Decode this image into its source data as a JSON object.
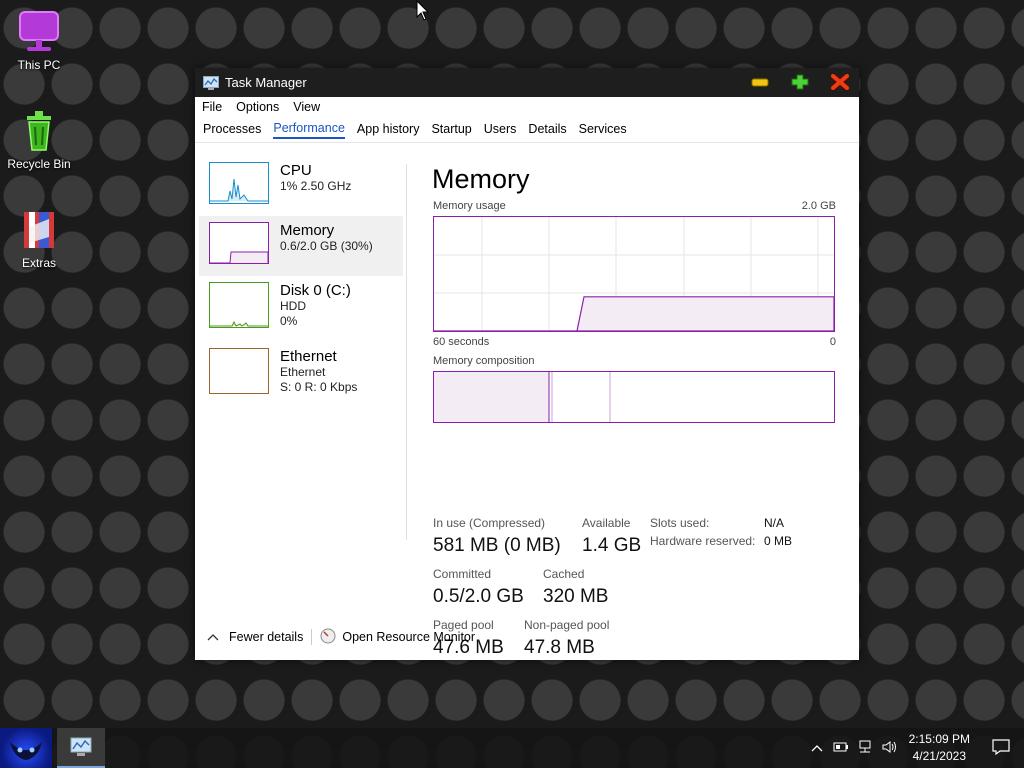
{
  "desktop": {
    "icons": [
      {
        "label": "This PC"
      },
      {
        "label": "Recycle Bin"
      },
      {
        "label": "Extras"
      }
    ]
  },
  "window": {
    "title": "Task Manager",
    "menu": [
      "File",
      "Options",
      "View"
    ],
    "tabs": [
      "Processes",
      "Performance",
      "App history",
      "Startup",
      "Users",
      "Details",
      "Services"
    ],
    "active_tab": "Performance"
  },
  "sidebar": {
    "items": [
      {
        "title": "CPU",
        "sub1": "1%  2.50 GHz",
        "sub2": "",
        "color": "#1a8fc7"
      },
      {
        "title": "Memory",
        "sub1": "0.6/2.0 GB (30%)",
        "sub2": "",
        "color": "#8b1fab"
      },
      {
        "title": "Disk 0 (C:)",
        "sub1": "HDD",
        "sub2": "0%",
        "color": "#4c9a1e"
      },
      {
        "title": "Ethernet",
        "sub1": "Ethernet",
        "sub2": "S: 0  R: 0 Kbps",
        "color": "#a0642a"
      }
    ]
  },
  "memory": {
    "title": "Memory",
    "usage_label": "Memory usage",
    "capacity": "2.0 GB",
    "time_left": "60 seconds",
    "time_right": "0",
    "usage_fraction": 0.3,
    "composition_label": "Memory composition",
    "stats": {
      "in_use_label": "In use (Compressed)",
      "in_use": "581 MB (0 MB)",
      "available_label": "Available",
      "available": "1.4 GB",
      "committed_label": "Committed",
      "committed": "0.5/2.0 GB",
      "cached_label": "Cached",
      "cached": "320 MB",
      "paged_label": "Paged pool",
      "paged": "47.6 MB",
      "nonpaged_label": "Non-paged pool",
      "nonpaged": "47.8 MB",
      "slots_label": "Slots used:",
      "slots": "N/A",
      "hwres_label": "Hardware reserved:",
      "hwres": "0 MB"
    }
  },
  "footer": {
    "fewer": "Fewer details",
    "monitor": "Open Resource Monitor"
  },
  "taskbar": {
    "time": "2:15:09 PM",
    "date": "4/21/2023"
  }
}
